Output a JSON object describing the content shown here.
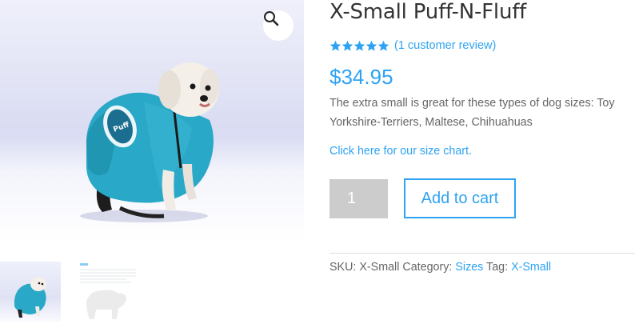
{
  "product": {
    "title": "X-Small Puff-N-Fluff",
    "rating": {
      "stars": 5,
      "max": 5,
      "review_link": "(1 customer review)"
    },
    "price": "$34.95",
    "description": "The extra small is great for these types of dog sizes:  Toy Yorkshire-Terriers, Maltese, Chihuahuas",
    "size_chart_link": "Click here for our size chart.",
    "quantity": "1",
    "add_to_cart_label": "Add to cart",
    "meta": {
      "sku_label": "SKU:",
      "sku_value": "X-Small",
      "category_label": "Category:",
      "category_value": "Sizes",
      "tag_label": "Tag:",
      "tag_value": "X-Small"
    }
  },
  "gallery": {
    "zoom_icon": "magnifier-icon",
    "thumbnails": [
      "dog-in-blue-puff-coat",
      "size-chart"
    ]
  },
  "colors": {
    "accent": "#2ea3f2",
    "coat": "#29a8c7",
    "star": "#2ea3f2",
    "qty_bg": "#cccccc"
  }
}
